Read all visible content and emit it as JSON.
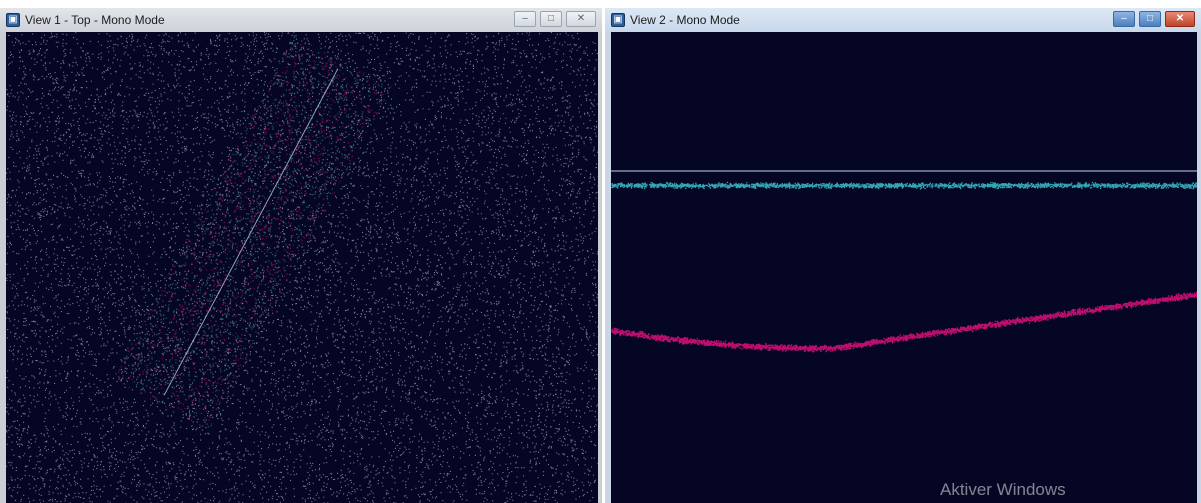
{
  "windows": [
    {
      "title": "View 1 - Top - Mono Mode",
      "icon": "app-icon",
      "controls": {
        "minimize": "–",
        "maximize": "□",
        "close": "✕"
      }
    },
    {
      "title": "View 2 - Mono Mode",
      "icon": "app-icon",
      "controls": {
        "minimize": "–",
        "maximize": "□",
        "close": "✕"
      }
    }
  ],
  "watermark": "Aktiver Windows",
  "colors": {
    "viewport_bg": "#050624",
    "noise_points": "#d6dbe6",
    "cyan_points": "#3ec3cc",
    "magenta_points": "#e0117a",
    "scan_line": "#bcd2ee"
  }
}
